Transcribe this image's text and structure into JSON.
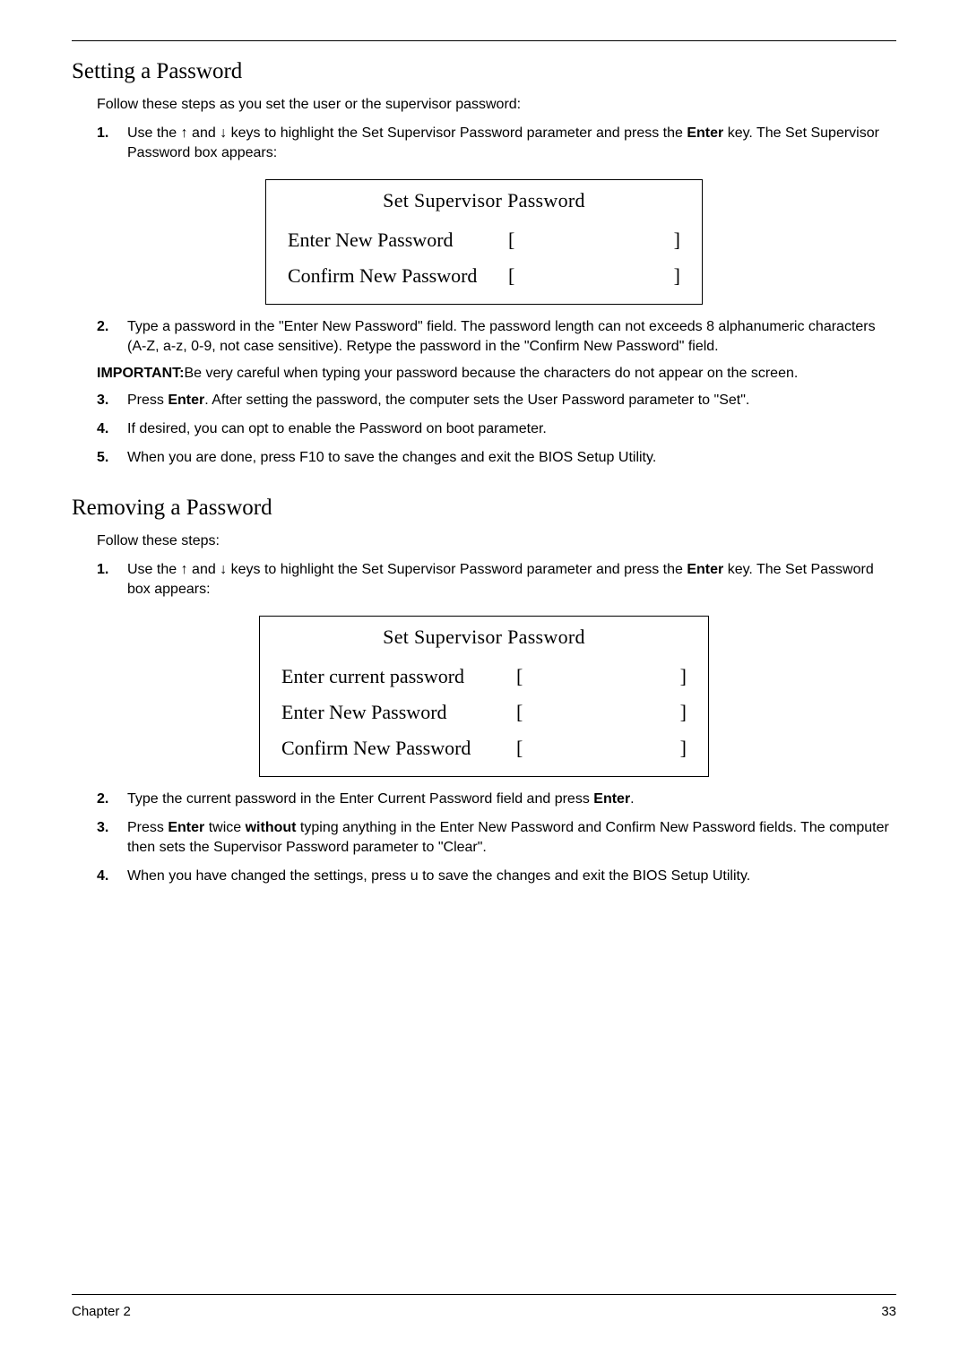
{
  "section1": {
    "heading": "Setting a Password",
    "intro": "Follow these steps as you set the user or the supervisor password:",
    "steps": {
      "s1_pre": "Use the ",
      "s1_mid": " and ",
      "s1_post": " keys to highlight the Set Supervisor Password parameter and press the ",
      "s1_key": "Enter",
      "s1_end": " key. The Set Supervisor Password box appears:",
      "s2": "Type a password in the \"Enter New Password\" field. The password length can not exceeds 8 alphanumeric characters (A-Z, a-z, 0-9, not case sensitive). Retype the password in the \"Confirm New Password\" field.",
      "s3_pre": "Press ",
      "s3_key": "Enter",
      "s3_post": ". After setting the password, the computer sets the User Password parameter to \"Set\".",
      "s4": "If desired, you can opt to enable the Password on boot parameter.",
      "s5": "When you are done, press F10 to save the changes and exit the BIOS Setup Utility."
    },
    "important_label": "IMPORTANT:",
    "important_text": "Be very careful when typing your password because the characters do not appear on the screen.",
    "dialog": {
      "title": "Set Supervisor Password",
      "row1": "Enter New Password",
      "row2": "Confirm New Password"
    }
  },
  "section2": {
    "heading": "Removing a Password",
    "intro": "Follow these steps:",
    "steps": {
      "s1_pre": "Use the ",
      "s1_mid": " and ",
      "s1_post": " keys to highlight the Set Supervisor Password parameter and press the ",
      "s1_key": "Enter",
      "s1_end": " key. The Set Password box appears:",
      "s2_pre": "Type the current password in the Enter Current Password field and press ",
      "s2_key": "Enter",
      "s2_post": ".",
      "s3_pre": "Press ",
      "s3_key1": "Enter",
      "s3_mid1": " twice ",
      "s3_key2": "without",
      "s3_post": " typing anything in the Enter New Password and Confirm New Password fields. The computer then sets the Supervisor Password parameter to \"Clear\".",
      "s4": "When you have changed the settings, press u to save the changes and exit the BIOS Setup Utility."
    },
    "dialog": {
      "title": "Set Supervisor Password",
      "row1": "Enter current password",
      "row2": "Enter New Password",
      "row3": "Confirm New Password"
    }
  },
  "arrows": {
    "up": "↑",
    "down": "↓"
  },
  "brackets": {
    "open": "[",
    "close": "]"
  },
  "nums": {
    "n1": "1.",
    "n2": "2.",
    "n3": "3.",
    "n4": "4.",
    "n5": "5."
  },
  "footer": {
    "left": "Chapter 2",
    "right": "33"
  }
}
